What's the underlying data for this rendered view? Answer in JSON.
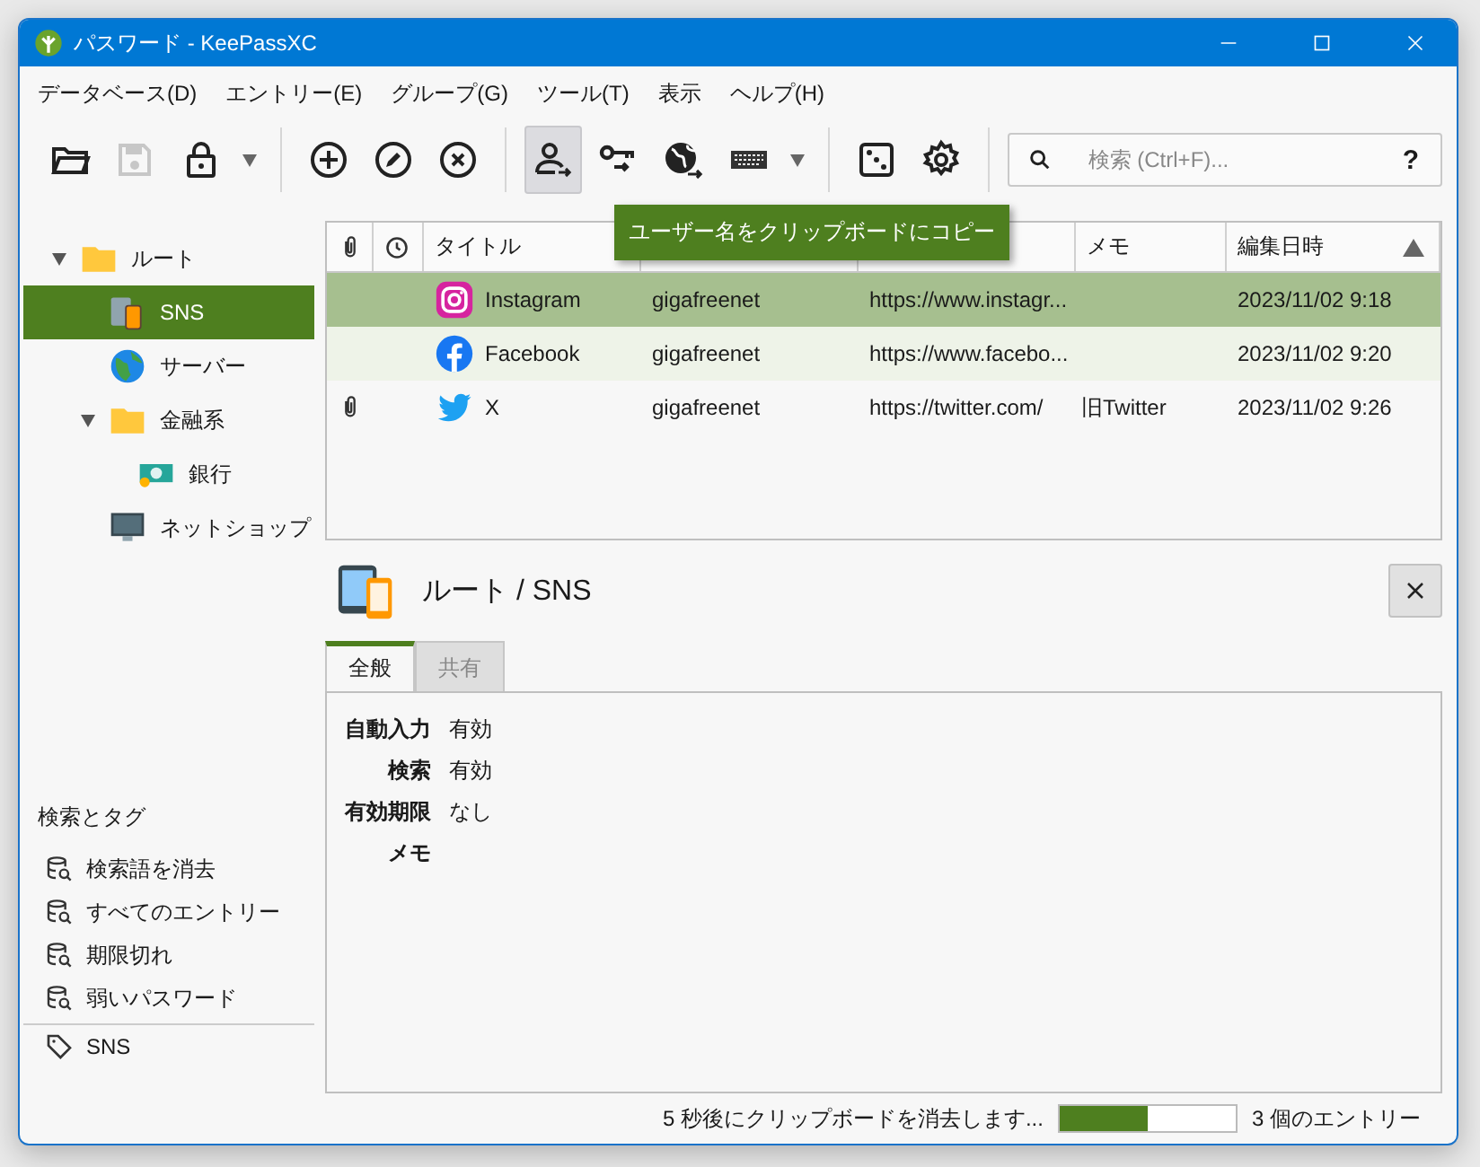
{
  "window": {
    "title": "パスワード - KeePassXC"
  },
  "menu": [
    "データベース(D)",
    "エントリー(E)",
    "グループ(G)",
    "ツール(T)",
    "表示",
    "ヘルプ(H)"
  ],
  "toolbar": [
    {
      "kind": "button",
      "disabled": false,
      "pressed": false
    },
    {
      "kind": "button",
      "disabled": true,
      "pressed": false
    },
    {
      "kind": "button",
      "disabled": false,
      "pressed": false
    },
    {
      "kind": "arrow"
    },
    {
      "kind": "separator"
    },
    {
      "kind": "button",
      "disabled": false,
      "pressed": false
    },
    {
      "kind": "button",
      "disabled": false,
      "pressed": false
    },
    {
      "kind": "button",
      "disabled": false,
      "pressed": false
    },
    {
      "kind": "separator"
    },
    {
      "kind": "button",
      "disabled": false,
      "pressed": true
    },
    {
      "kind": "button",
      "disabled": false,
      "pressed": false
    },
    {
      "kind": "button",
      "disabled": false,
      "pressed": false
    },
    {
      "kind": "button",
      "disabled": false,
      "pressed": false
    },
    {
      "kind": "arrow"
    },
    {
      "kind": "separator"
    },
    {
      "kind": "button",
      "disabled": false,
      "pressed": false
    },
    {
      "kind": "button",
      "disabled": false,
      "pressed": false
    },
    {
      "kind": "separator"
    }
  ],
  "search": {
    "placeholder": "検索 (Ctrl+F)...",
    "help": "?"
  },
  "tooltip": {
    "text": "ユーザー名をクリップボードにコピー"
  },
  "tree": [
    {
      "label": "ルート",
      "expanded": true,
      "selected": false,
      "children": [
        {
          "label": "SNS",
          "selected": true
        },
        {
          "label": "サーバー",
          "selected": false
        },
        {
          "label": "金融系",
          "expanded": true,
          "selected": false,
          "children": [
            {
              "label": "銀行",
              "selected": false
            }
          ]
        },
        {
          "label": "ネットショップ",
          "selected": false
        }
      ]
    }
  ],
  "search_tags": {
    "title": "検索とタグ",
    "searches": [
      "検索語を消去",
      "すべてのエントリー",
      "期限切れ",
      "弱いパスワード"
    ],
    "tags": [
      "SNS"
    ]
  },
  "table": {
    "columns": [
      {
        "kind": "attachment"
      },
      {
        "kind": "clock"
      },
      {
        "kind": "text",
        "label": "タイトル"
      },
      {
        "kind": "covered"
      },
      {
        "kind": "covered"
      },
      {
        "kind": "text",
        "label": "メモ"
      },
      {
        "kind": "text",
        "label": "編集日時",
        "sorted": true
      }
    ],
    "rows": [
      {
        "selected": true,
        "attachment": false,
        "title": "Instagram",
        "username": "gigafreenet",
        "url": "https://www.instagr...",
        "modified": "2023/11/02 9:18"
      },
      {
        "selected": false,
        "attachment": false,
        "title": "Facebook",
        "username": "gigafreenet",
        "url": "https://www.facebo...",
        "modified": "2023/11/02 9:20"
      },
      {
        "selected": false,
        "attachment": true,
        "title": "X",
        "username": "gigafreenet",
        "url": "https://twitter.com/",
        "notes": "旧Twitter",
        "modified": "2023/11/02 9:26"
      }
    ]
  },
  "detail": {
    "path": "ルート / SNS",
    "tabs": [
      {
        "label": "全般",
        "selected": true
      },
      {
        "label": "共有",
        "selected": false
      }
    ],
    "fields": [
      {
        "label": "自動入力",
        "value": "有効"
      },
      {
        "label": "検索",
        "value": "有効"
      },
      {
        "label": "有効期限",
        "value": "なし"
      },
      {
        "label": "メモ"
      }
    ]
  },
  "status": {
    "message": "5 秒後にクリップボードを消去します...",
    "level": 0.5,
    "count": "3 個のエントリー"
  }
}
